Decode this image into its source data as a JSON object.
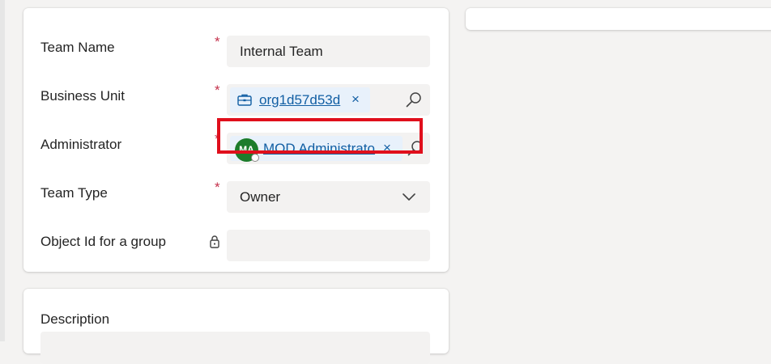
{
  "form": {
    "fields": {
      "team_name": {
        "label": "Team Name",
        "required_marker": "*",
        "value": "Internal Team"
      },
      "business_unit": {
        "label": "Business Unit",
        "required_marker": "*",
        "value": "org1d57d53d",
        "remove_glyph": "×"
      },
      "administrator": {
        "label": "Administrator",
        "required_marker": "*",
        "avatar_initials": "MA",
        "value": "MOD Administrator",
        "display_value": "MOD Administrato",
        "remove_glyph": "×"
      },
      "team_type": {
        "label": "Team Type",
        "required_marker": "*",
        "value": "Owner"
      },
      "object_id": {
        "label": "Object Id for a group",
        "value": ""
      }
    },
    "description": {
      "label": "Description",
      "value": ""
    }
  },
  "colors": {
    "required": "#c4314b",
    "link": "#115ea3",
    "avatar_bg": "#1c7c2b",
    "highlight": "#e00f1c",
    "field_bg": "#f3f2f1"
  },
  "icons": {
    "business_unit_icon": "briefcase-icon",
    "lookup_icon": "search-icon",
    "dropdown_icon": "chevron-down-icon",
    "locked_icon": "lock-icon"
  }
}
